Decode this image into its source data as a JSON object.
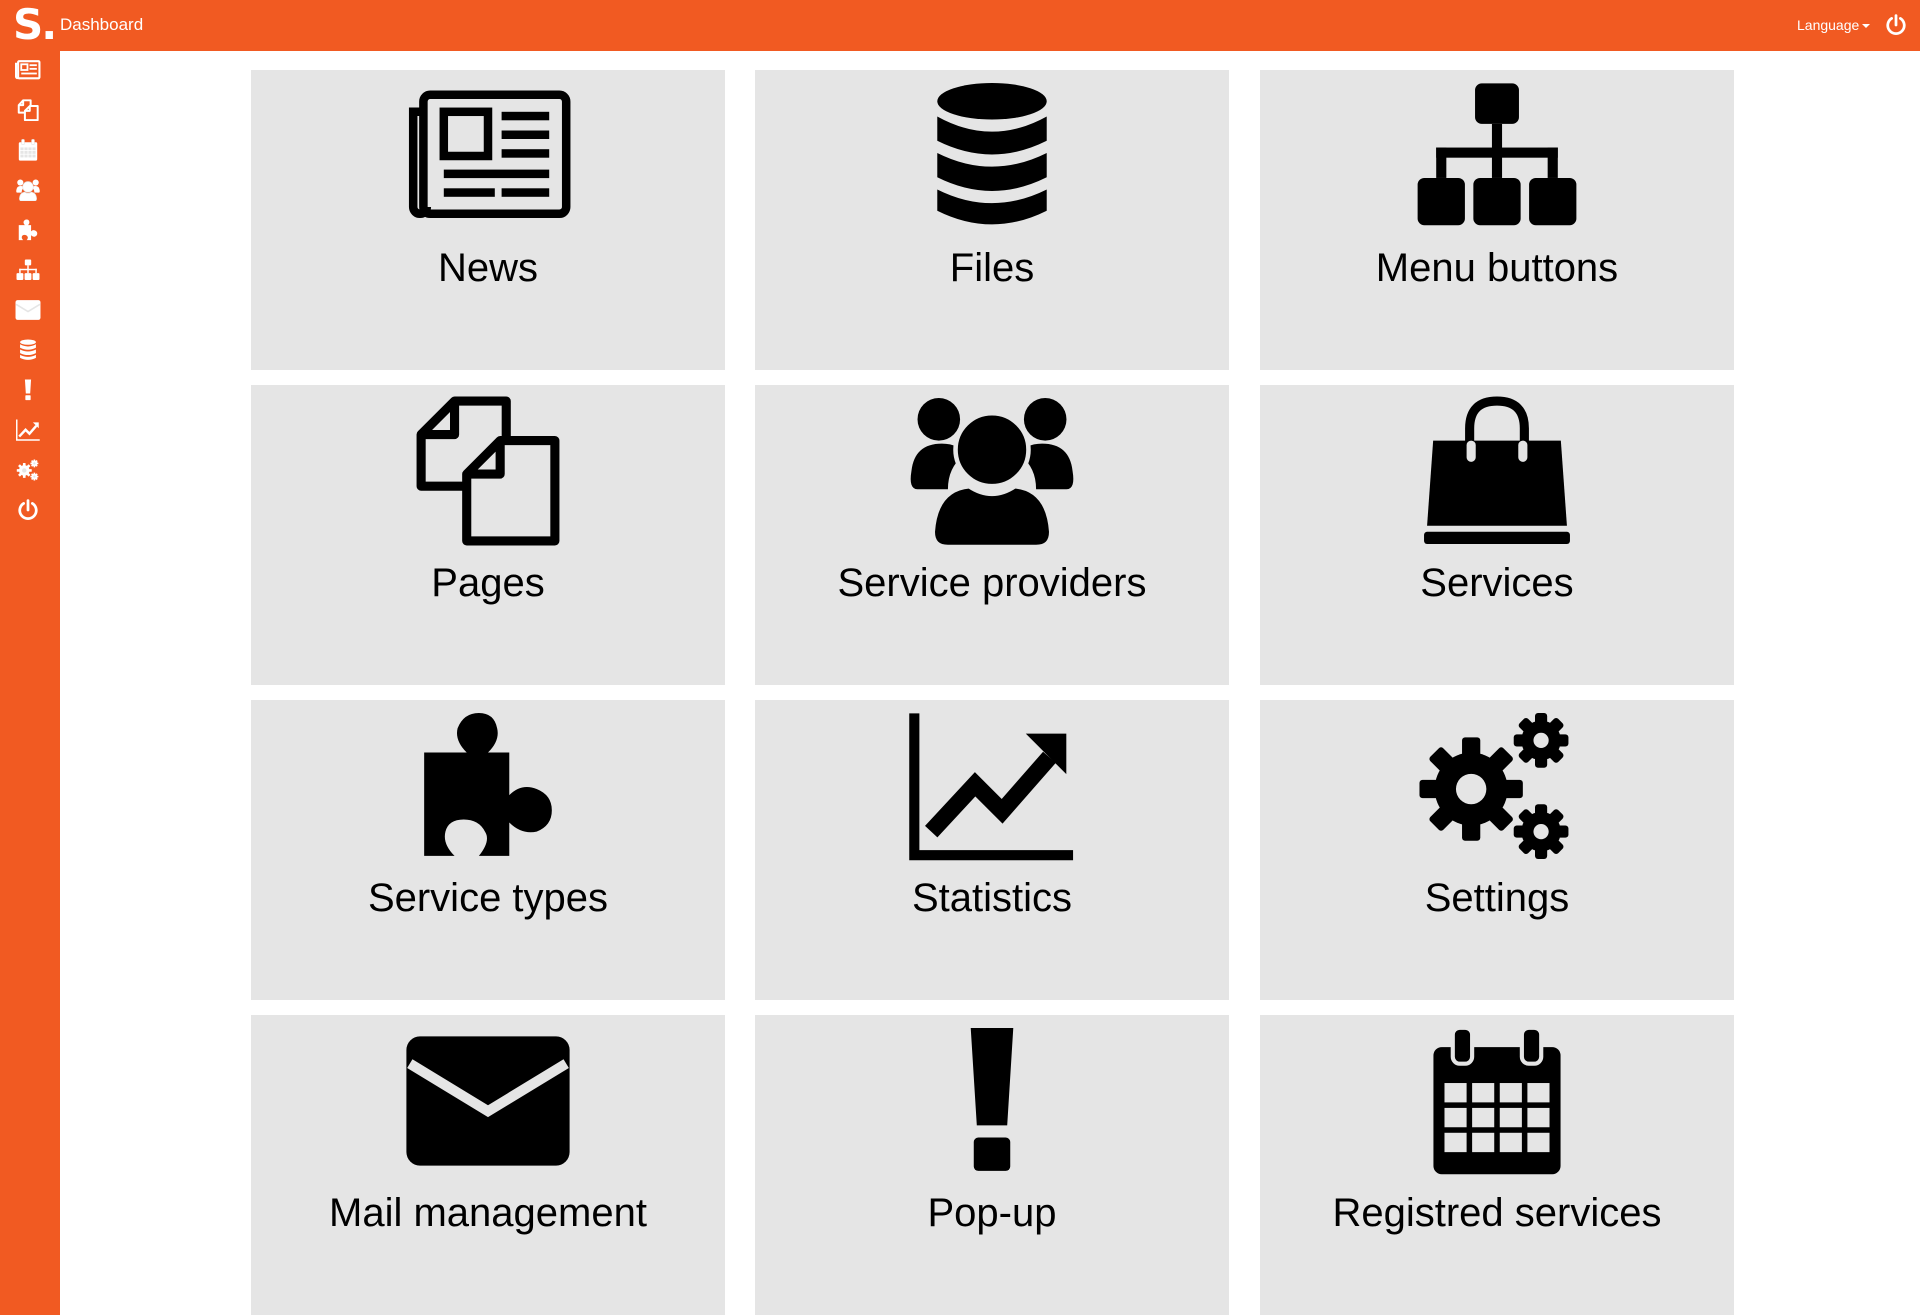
{
  "header": {
    "logo_text": "S.",
    "page_title": "Dashboard",
    "language_label": "Language",
    "power_icon": "power-icon"
  },
  "sidebar": {
    "items": [
      {
        "icon": "newspaper-icon"
      },
      {
        "icon": "pages-icon"
      },
      {
        "icon": "calendar-icon"
      },
      {
        "icon": "users-icon"
      },
      {
        "icon": "puzzle-icon"
      },
      {
        "icon": "sitemap-icon"
      },
      {
        "icon": "envelope-icon"
      },
      {
        "icon": "database-icon"
      },
      {
        "icon": "exclamation-icon"
      },
      {
        "icon": "line-chart-icon"
      },
      {
        "icon": "gears-icon"
      },
      {
        "icon": "power-icon"
      }
    ]
  },
  "tiles": [
    {
      "label": "News",
      "icon": "newspaper-icon"
    },
    {
      "label": "Files",
      "icon": "database-icon"
    },
    {
      "label": "Menu buttons",
      "icon": "sitemap-icon"
    },
    {
      "label": "Pages",
      "icon": "pages-icon"
    },
    {
      "label": "Service providers",
      "icon": "users-icon"
    },
    {
      "label": "Services",
      "icon": "shopping-bag-icon"
    },
    {
      "label": "Service types",
      "icon": "puzzle-icon"
    },
    {
      "label": "Statistics",
      "icon": "line-chart-icon"
    },
    {
      "label": "Settings",
      "icon": "gears-icon"
    },
    {
      "label": "Mail management",
      "icon": "envelope-icon"
    },
    {
      "label": "Pop-up",
      "icon": "exclamation-icon"
    },
    {
      "label": "Registred services",
      "icon": "calendar-icon"
    }
  ],
  "colors": {
    "brand": "#f15a22",
    "tile_bg": "#e5e5e5",
    "icon": "#000000"
  }
}
